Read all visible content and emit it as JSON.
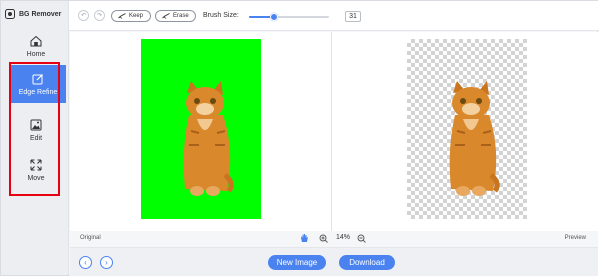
{
  "app": {
    "title": "BG Remover",
    "logo_icon": "bg-remover-logo-icon"
  },
  "sidebar": {
    "items": [
      {
        "label": "Home",
        "icon": "home-icon",
        "active": false
      },
      {
        "label": "Edge Refine",
        "icon": "edge-refine-icon",
        "active": true
      },
      {
        "label": "Edit",
        "icon": "image-edit-icon",
        "active": false
      },
      {
        "label": "Move",
        "icon": "move-arrows-icon",
        "active": false
      }
    ],
    "highlight_color": "#e60012"
  },
  "toolbar": {
    "undo_icon": "undo-icon",
    "redo_icon": "redo-icon",
    "keep_label": "Keep",
    "erase_label": "Erase",
    "brush_size_label": "Brush Size:",
    "brush_size_value": "31",
    "brush_size_fraction": 0.31
  },
  "canvas": {
    "original_background": "#00ff00",
    "preview_background": "transparent-checkerboard"
  },
  "statusbar": {
    "left_label": "Original",
    "right_label": "Preview",
    "zoom_level": "14%"
  },
  "bottombar": {
    "new_image_label": "New Image",
    "download_label": "Download"
  },
  "colors": {
    "accent": "#4a82f0"
  }
}
